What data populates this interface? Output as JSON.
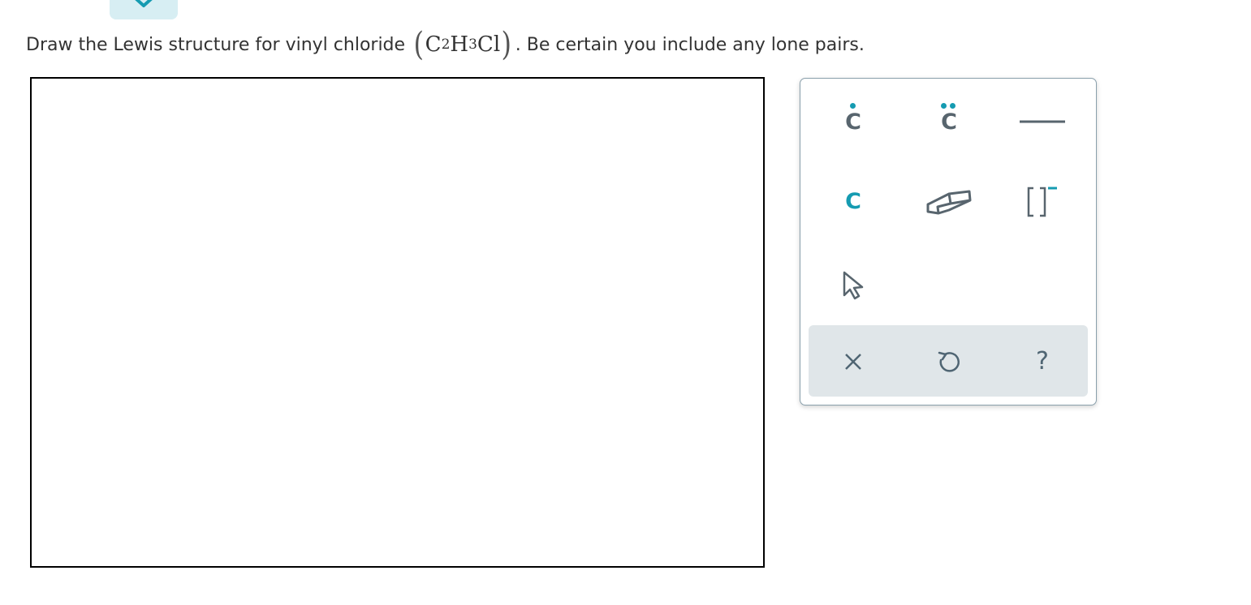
{
  "question": {
    "text_before": "Draw the Lewis structure for vinyl chloride",
    "formula": {
      "open_paren": "(",
      "c_symbol": "C",
      "c_count": "2",
      "h_symbol": "H",
      "h_count": "3",
      "cl_symbol": "Cl",
      "close_paren": ")"
    },
    "text_after": ". Be certain you include any lone pairs."
  },
  "palette": {
    "tools": [
      {
        "name": "single-electron-carbon",
        "label": "C",
        "icon": "radical-dot-icon"
      },
      {
        "name": "lone-pair-carbon",
        "label": "C",
        "icon": "lone-pair-icon"
      },
      {
        "name": "bond",
        "icon": "single-bond-icon"
      },
      {
        "name": "atom-carbon",
        "label": "C"
      },
      {
        "name": "eraser",
        "icon": "eraser-icon"
      },
      {
        "name": "charge-bracket",
        "icon": "bracket-charge-icon"
      },
      {
        "name": "select",
        "icon": "cursor-arrow-icon"
      }
    ],
    "actions": [
      {
        "name": "clear",
        "icon": "close-icon"
      },
      {
        "name": "undo",
        "icon": "undo-icon"
      },
      {
        "name": "help",
        "label": "?",
        "icon": "help-icon"
      }
    ]
  },
  "colors": {
    "accent": "#159bb1",
    "icon_gray": "#58656e",
    "action_bar_bg": "#e0e6e9",
    "palette_border": "#8aa0ac",
    "tab_bg": "#d7eef3"
  }
}
